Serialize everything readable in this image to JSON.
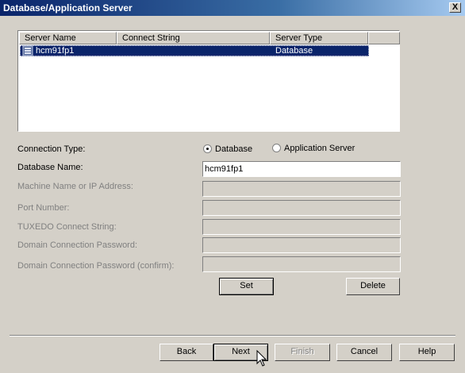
{
  "window": {
    "title": "Database/Application Server",
    "close_glyph": "X"
  },
  "server_list": {
    "columns": [
      "Server Name",
      "Connect String",
      "Server Type",
      ""
    ],
    "rows": [
      {
        "server_name": "hcm91fp1",
        "connect_string": "",
        "server_type": "Database",
        "selected": true
      }
    ]
  },
  "form": {
    "connection_type_label": "Connection Type:",
    "radio_database_label": "Database",
    "radio_appserver_label": "Application Server",
    "selected_connection_type": "Database",
    "database_name_label": "Database Name:",
    "database_name_value": "hcm91fp1",
    "machine_name_label": "Machine Name or IP Address:",
    "port_number_label": "Port Number:",
    "tuxedo_label": "TUXEDO Connect String:",
    "domain_password_label": "Domain Connection Password:",
    "domain_password_confirm_label": "Domain Connection Password (confirm):"
  },
  "buttons": {
    "set": "Set",
    "delete": "Delete",
    "back": "Back",
    "next": "Next",
    "finish": "Finish",
    "cancel": "Cancel",
    "help": "Help"
  },
  "colors": {
    "selection": "#0a246a",
    "dialog_bg": "#d4d0c8",
    "title_gradient_start": "#0a246a"
  },
  "icons": {
    "row_icon": "database-server-icon",
    "cursor": "mouse-pointer-icon"
  }
}
